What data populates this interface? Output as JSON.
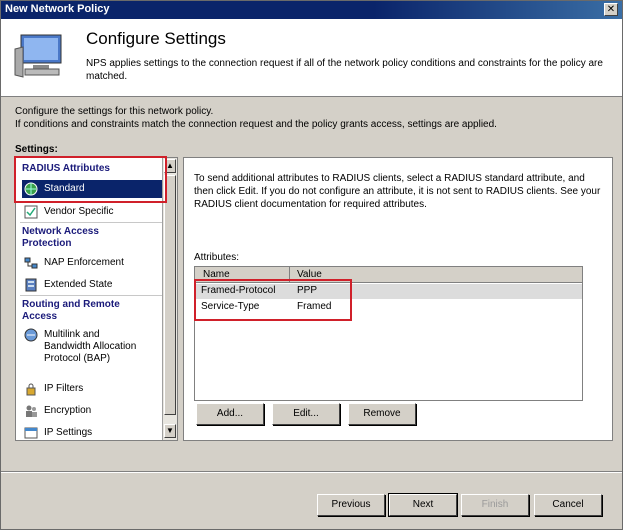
{
  "window": {
    "title": "New Network Policy"
  },
  "header": {
    "title": "Configure Settings",
    "description": "NPS applies settings to the connection request if all of the network policy conditions and constraints for the policy are matched."
  },
  "intro": {
    "line1": "Configure the settings for this network policy.",
    "line2": "If conditions and constraints match the connection request and the policy grants access, settings are applied."
  },
  "settings_label": "Settings:",
  "sidebar": {
    "groups": {
      "radius": "RADIUS Attributes",
      "nap": "Network Access Protection",
      "routing": "Routing and Remote Access"
    },
    "items": {
      "standard": "Standard",
      "vendor": "Vendor Specific",
      "nap_enforcement": "NAP Enforcement",
      "extended_state": "Extended State",
      "multilink": "Multilink and Bandwidth Allocation Protocol (BAP)",
      "ip_filters": "IP Filters",
      "encryption": "Encryption",
      "ip_settings": "IP Settings"
    }
  },
  "main": {
    "instructions": "To send additional attributes to RADIUS clients, select a RADIUS standard attribute, and then click Edit. If you do not configure an attribute, it is not sent to RADIUS clients. See your RADIUS client documentation for required attributes.",
    "attributes_label": "Attributes:",
    "columns": {
      "name": "Name",
      "value": "Value"
    },
    "rows": [
      {
        "name": "Framed-Protocol",
        "value": "PPP"
      },
      {
        "name": "Service-Type",
        "value": "Framed"
      }
    ],
    "buttons": {
      "add": "Add...",
      "edit": "Edit...",
      "remove": "Remove"
    }
  },
  "footer": {
    "previous": "Previous",
    "next": "Next",
    "finish": "Finish",
    "cancel": "Cancel"
  },
  "colors": {
    "highlight": "#d0202a",
    "selection": "#0a246a"
  }
}
